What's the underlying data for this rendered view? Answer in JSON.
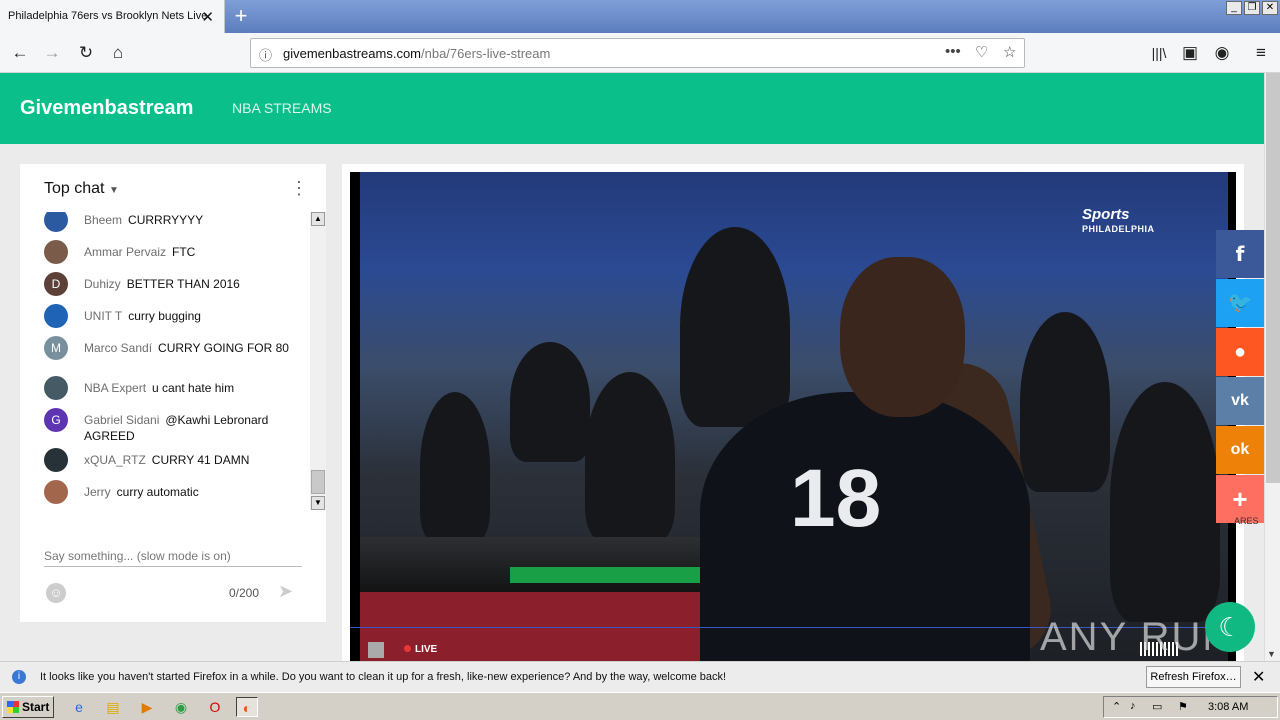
{
  "browser": {
    "tab_title": "Philadelphia 76ers vs Brooklyn Nets Live",
    "tab_close": "✕",
    "new_tab": "+",
    "url_host": "givemenbastreams.com",
    "url_path": "/nba/76ers-live-stream",
    "window_buttons": [
      "_",
      "❐",
      "✕"
    ]
  },
  "site": {
    "brand": "Givemenbastream",
    "nav_link": "NBA STREAMS"
  },
  "chat": {
    "title": "Top chat",
    "messages": [
      {
        "author": "Bheem",
        "text": "CURRRYYYY",
        "avatar": "",
        "color": "#2c5aa0"
      },
      {
        "author": "Ammar Pervaiz",
        "text": "FTC",
        "avatar": "",
        "color": "#7a5b4a"
      },
      {
        "author": "Duhizy",
        "text": "BETTER THAN 2016",
        "avatar": "D",
        "color": "#5d4037"
      },
      {
        "author": "UNIT T",
        "text": "curry bugging",
        "avatar": "",
        "color": "#1e63b5"
      },
      {
        "author": "Marco Sandí",
        "text": "CURRY GOING FOR 80",
        "avatar": "M",
        "color": "#78909c"
      },
      {
        "author": "NBA Expert",
        "text": "u cant hate him",
        "avatar": "",
        "color": "#455a64"
      },
      {
        "author": "Gabriel Sidani",
        "text": "@Kawhi Lebronard AGREED",
        "avatar": "G",
        "color": "#5e35b1"
      },
      {
        "author": "xQUA_RTZ",
        "text": "CURRY 41 DAMN",
        "avatar": "",
        "color": "#263238"
      },
      {
        "author": "Jerry",
        "text": "curry automatic",
        "avatar": "",
        "color": "#a1664b"
      }
    ],
    "input_placeholder": "Say something... (slow mode is on)",
    "counter": "0/200"
  },
  "video": {
    "network": "Sports",
    "network_sub": "PHILADELPHIA",
    "jersey_number": "18",
    "live_label": "LIVE"
  },
  "share": {
    "buttons": [
      {
        "name": "facebook",
        "glyph": "f",
        "color": "#3b5998"
      },
      {
        "name": "twitter",
        "glyph": "🐦",
        "color": "#1da1f2"
      },
      {
        "name": "reddit",
        "glyph": "●",
        "color": "#ff5722"
      },
      {
        "name": "vk",
        "glyph": "vk",
        "color": "#5b7fa6"
      },
      {
        "name": "odnoklassniki",
        "glyph": "ok",
        "color": "#ee8208"
      },
      {
        "name": "more",
        "glyph": "+",
        "color": "#ff6f61"
      }
    ],
    "label": "ARES"
  },
  "watermark": "ANY RUN",
  "notification": {
    "text": "It looks like you haven't started Firefox in a while. Do you want to clean it up for a fresh, like-new experience? And by the way, welcome back!",
    "button": "Refresh Firefox…"
  },
  "taskbar": {
    "start": "Start",
    "clock": "3:08 AM"
  }
}
